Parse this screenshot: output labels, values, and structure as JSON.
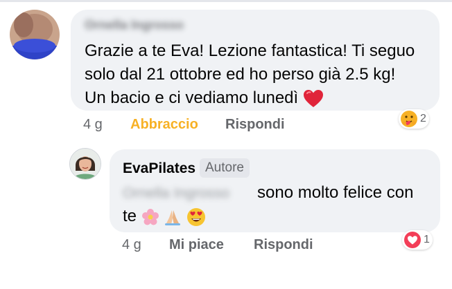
{
  "comment": {
    "author": "Ornella Ingrosso",
    "text_lines": [
      "Grazie a te Eva! Lezione fantastica! Ti seguo",
      "solo dal 21 ottobre ed ho perso già 2.5 kg!",
      "Un bacio e ci vediamo lunedì"
    ],
    "emoji_end": "red-heart-icon",
    "time": "4 g",
    "reaction_label": "Abbraccio",
    "reply_label": "Rispondi",
    "reaction_count": "2",
    "reaction_icon": "care-reaction-icon",
    "reaction_color": "#f7b125"
  },
  "reply": {
    "author": "EvaPilates",
    "author_tag": "Autore",
    "mention": "Ornella Ingrosso",
    "text_line1": "sono molto felice con",
    "text_line2": "te",
    "emojis": [
      "cherry-blossom-icon",
      "folded-hands-icon",
      "heart-eyes-icon"
    ],
    "time": "4 g",
    "like_label": "Mi piace",
    "reply_label": "Rispondi",
    "reaction_count": "1",
    "reaction_icon": "love-reaction-icon"
  },
  "colors": {
    "bubble": "#f0f2f5",
    "secondary_text": "#65676b",
    "love": "#f33e58"
  }
}
